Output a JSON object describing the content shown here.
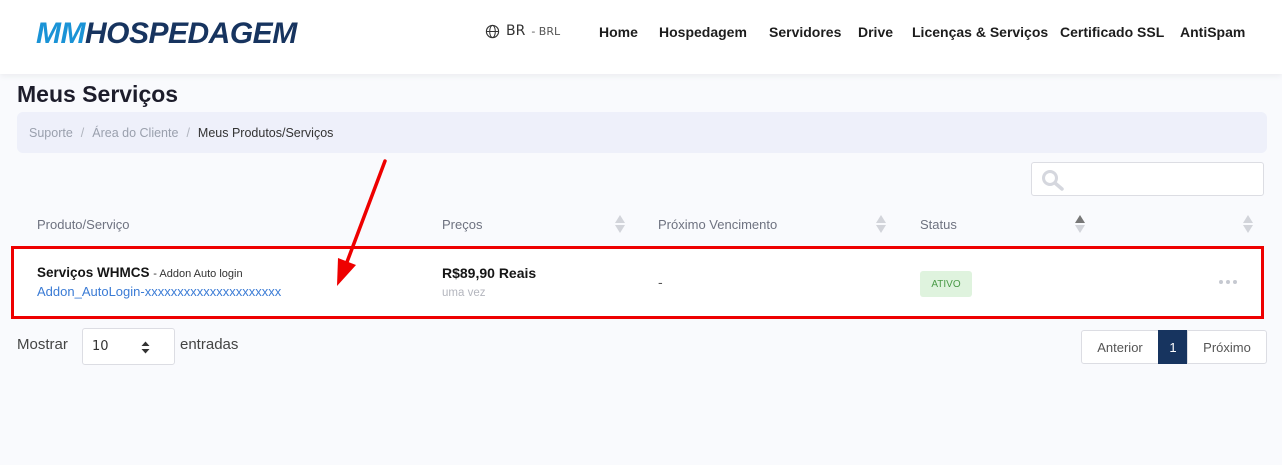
{
  "header": {
    "logo_mm": "MM",
    "logo_rest": "HOSPEDAGEM",
    "lang_code": "BR",
    "currency": "- BRL",
    "nav": [
      "Home",
      "Hospedagem",
      "Servidores",
      "Drive",
      "Licenças & Serviços",
      "Certificado SSL",
      "AntiSpam"
    ]
  },
  "page": {
    "title": "Meus Serviços",
    "breadcrumb": [
      "Suporte",
      "Área do Cliente",
      "Meus Produtos/Serviços"
    ]
  },
  "search": {
    "placeholder": "",
    "value": ""
  },
  "table": {
    "headers": [
      "Produto/Serviço",
      "Preços",
      "Próximo Vencimento",
      "Status"
    ],
    "rows": [
      {
        "product": "Serviços WHMCS",
        "product_group": "- Addon Auto login",
        "domain": "Addon_AutoLogin-xxxxxxxxxxxxxxxxxxxxx",
        "price": "R$89,90 Reais",
        "cycle": "uma vez",
        "next_due": "-",
        "status": "ATIVO"
      }
    ]
  },
  "footer": {
    "show_label": "Mostrar",
    "page_size": "10",
    "entries_label": "entradas",
    "prev": "Anterior",
    "current_page": "1",
    "next": "Próximo"
  },
  "colors": {
    "brand_light": "#1a93d6",
    "brand_dark": "#17345f",
    "annotation": "#ee0000",
    "status_ok_bg": "#dff3de",
    "status_ok_fg": "#4a9a47"
  }
}
